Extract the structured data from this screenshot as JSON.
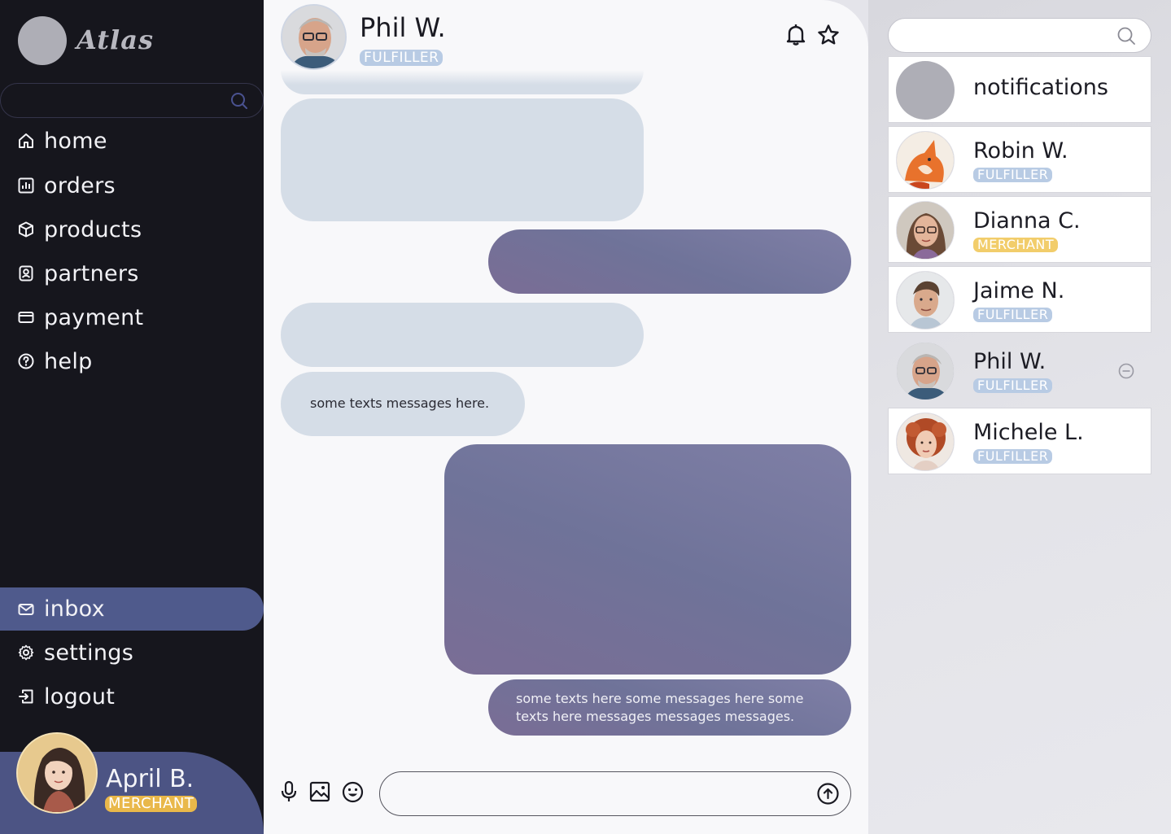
{
  "app": {
    "name": "Atlas"
  },
  "sidebar": {
    "search": {
      "placeholder": ""
    },
    "nav": [
      {
        "label": "home",
        "icon": "home-icon"
      },
      {
        "label": "orders",
        "icon": "chart-icon"
      },
      {
        "label": "products",
        "icon": "box-icon"
      },
      {
        "label": "partners",
        "icon": "contact-icon"
      },
      {
        "label": "payment",
        "icon": "card-icon"
      },
      {
        "label": "help",
        "icon": "help-icon"
      }
    ],
    "bottom_nav": [
      {
        "label": "inbox",
        "icon": "mail-icon",
        "active": true
      },
      {
        "label": "settings",
        "icon": "gear-icon"
      },
      {
        "label": "logout",
        "icon": "logout-icon"
      }
    ],
    "user": {
      "name": "April B.",
      "role": "MERCHANT"
    }
  },
  "chat": {
    "contact_name": "Phil W.",
    "contact_role": "FULFILLER",
    "messages": [
      {
        "direction": "in",
        "text": ""
      },
      {
        "direction": "out",
        "text": ""
      },
      {
        "direction": "in",
        "text": ""
      },
      {
        "direction": "in",
        "text": "some texts messages here."
      },
      {
        "direction": "out",
        "text": ""
      },
      {
        "direction": "out",
        "text": "some texts here some messages here some texts here messages messages messages."
      }
    ],
    "composer_placeholder": ""
  },
  "contacts": {
    "search_placeholder": "",
    "items": [
      {
        "name": "notifications",
        "role": ""
      },
      {
        "name": "Robin W.",
        "role": "FULFILLER"
      },
      {
        "name": "Dianna C.",
        "role": "MERCHANT"
      },
      {
        "name": "Jaime N.",
        "role": "FULFILLER"
      },
      {
        "name": "Phil W.",
        "role": "FULFILLER",
        "selected": true
      },
      {
        "name": "Michele L.",
        "role": "FULFILLER"
      }
    ]
  },
  "colors": {
    "sidebar_bg": "#16161d",
    "accent": "#4f5a8c",
    "fulfiller_badge": "#b8cbe4",
    "merchant_badge": "#f2cd6b",
    "incoming_bubble": "#d5dde7",
    "outgoing_bubble": "#737499"
  }
}
